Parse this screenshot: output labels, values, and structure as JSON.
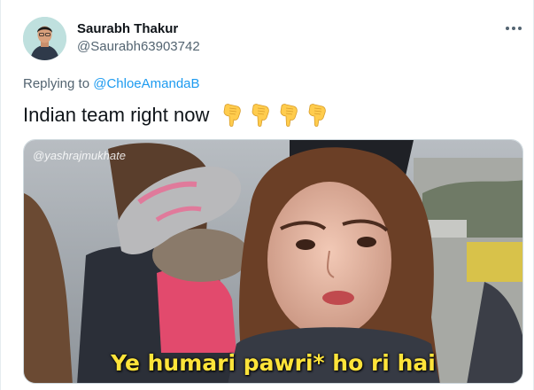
{
  "tweet": {
    "author_name": "Saurabh Thakur",
    "author_handle": "@Saurabh63903742",
    "replying_prefix": "Replying to",
    "replying_handle": "@ChloeAmandaB",
    "text": "Indian team right now",
    "emoji_icons": [
      "backhand-index-pointing-down-icon",
      "backhand-index-pointing-down-icon",
      "backhand-index-pointing-down-icon",
      "backhand-index-pointing-down-icon"
    ],
    "media": {
      "watermark": "@yashrajmukhate",
      "caption": "Ye humari pawri* ho ri hai"
    }
  },
  "colors": {
    "text_primary": "#0f1419",
    "text_secondary": "#536471",
    "link": "#1d9bf0",
    "caption": "#ffe43a"
  }
}
